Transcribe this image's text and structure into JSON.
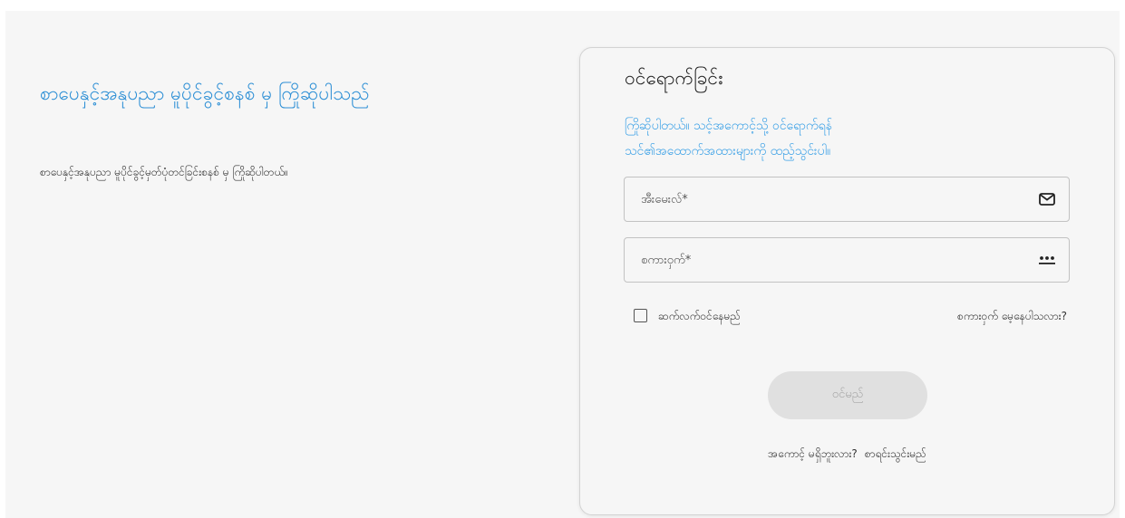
{
  "colors": {
    "accent": "#2d8fd5",
    "subtitle": "#3aa0e6",
    "background": "#f6f6f6",
    "disabled_button_bg": "#e0e0e0",
    "disabled_button_text": "#a7a7a7"
  },
  "welcome": {
    "title": "စာပေနှင့်အနုပညာ မူပိုင်ခွင့်စနစ် မှ ကြိုဆိုပါသည်",
    "text": "စာပေနှင့်အနုပညာ မူပိုင်ခွင့်မှတ်ပုံတင်ခြင်းစနစ် မှ ကြိုဆိုပါတယ်။"
  },
  "login": {
    "title": "ဝင်ရောက်ခြင်း",
    "subtitle_line1": "ကြိုဆိုပါတယ်။ သင့်အကောင့်သို့ ဝင်ရောက်ရန်",
    "subtitle_line2": "သင်၏အထောက်အထားများကို ထည့်သွင်းပါ။",
    "email": {
      "placeholder": "အီးမေးလ်*",
      "value": "",
      "icon": "envelope-icon"
    },
    "password": {
      "placeholder": "စကားဝှက်*",
      "value": "",
      "icon": "password-dots-icon"
    },
    "remember_label": "ဆက်လက်ဝင်နေမည်",
    "remember_checked": false,
    "forgot_label": "စကားဝှက် မေ့နေပါသလား?",
    "submit_label": "ဝင်မည်",
    "no_account_text": "အကောင့် မရှိဘူးလား?",
    "register_label": "စာရင်းသွင်းမည်"
  }
}
